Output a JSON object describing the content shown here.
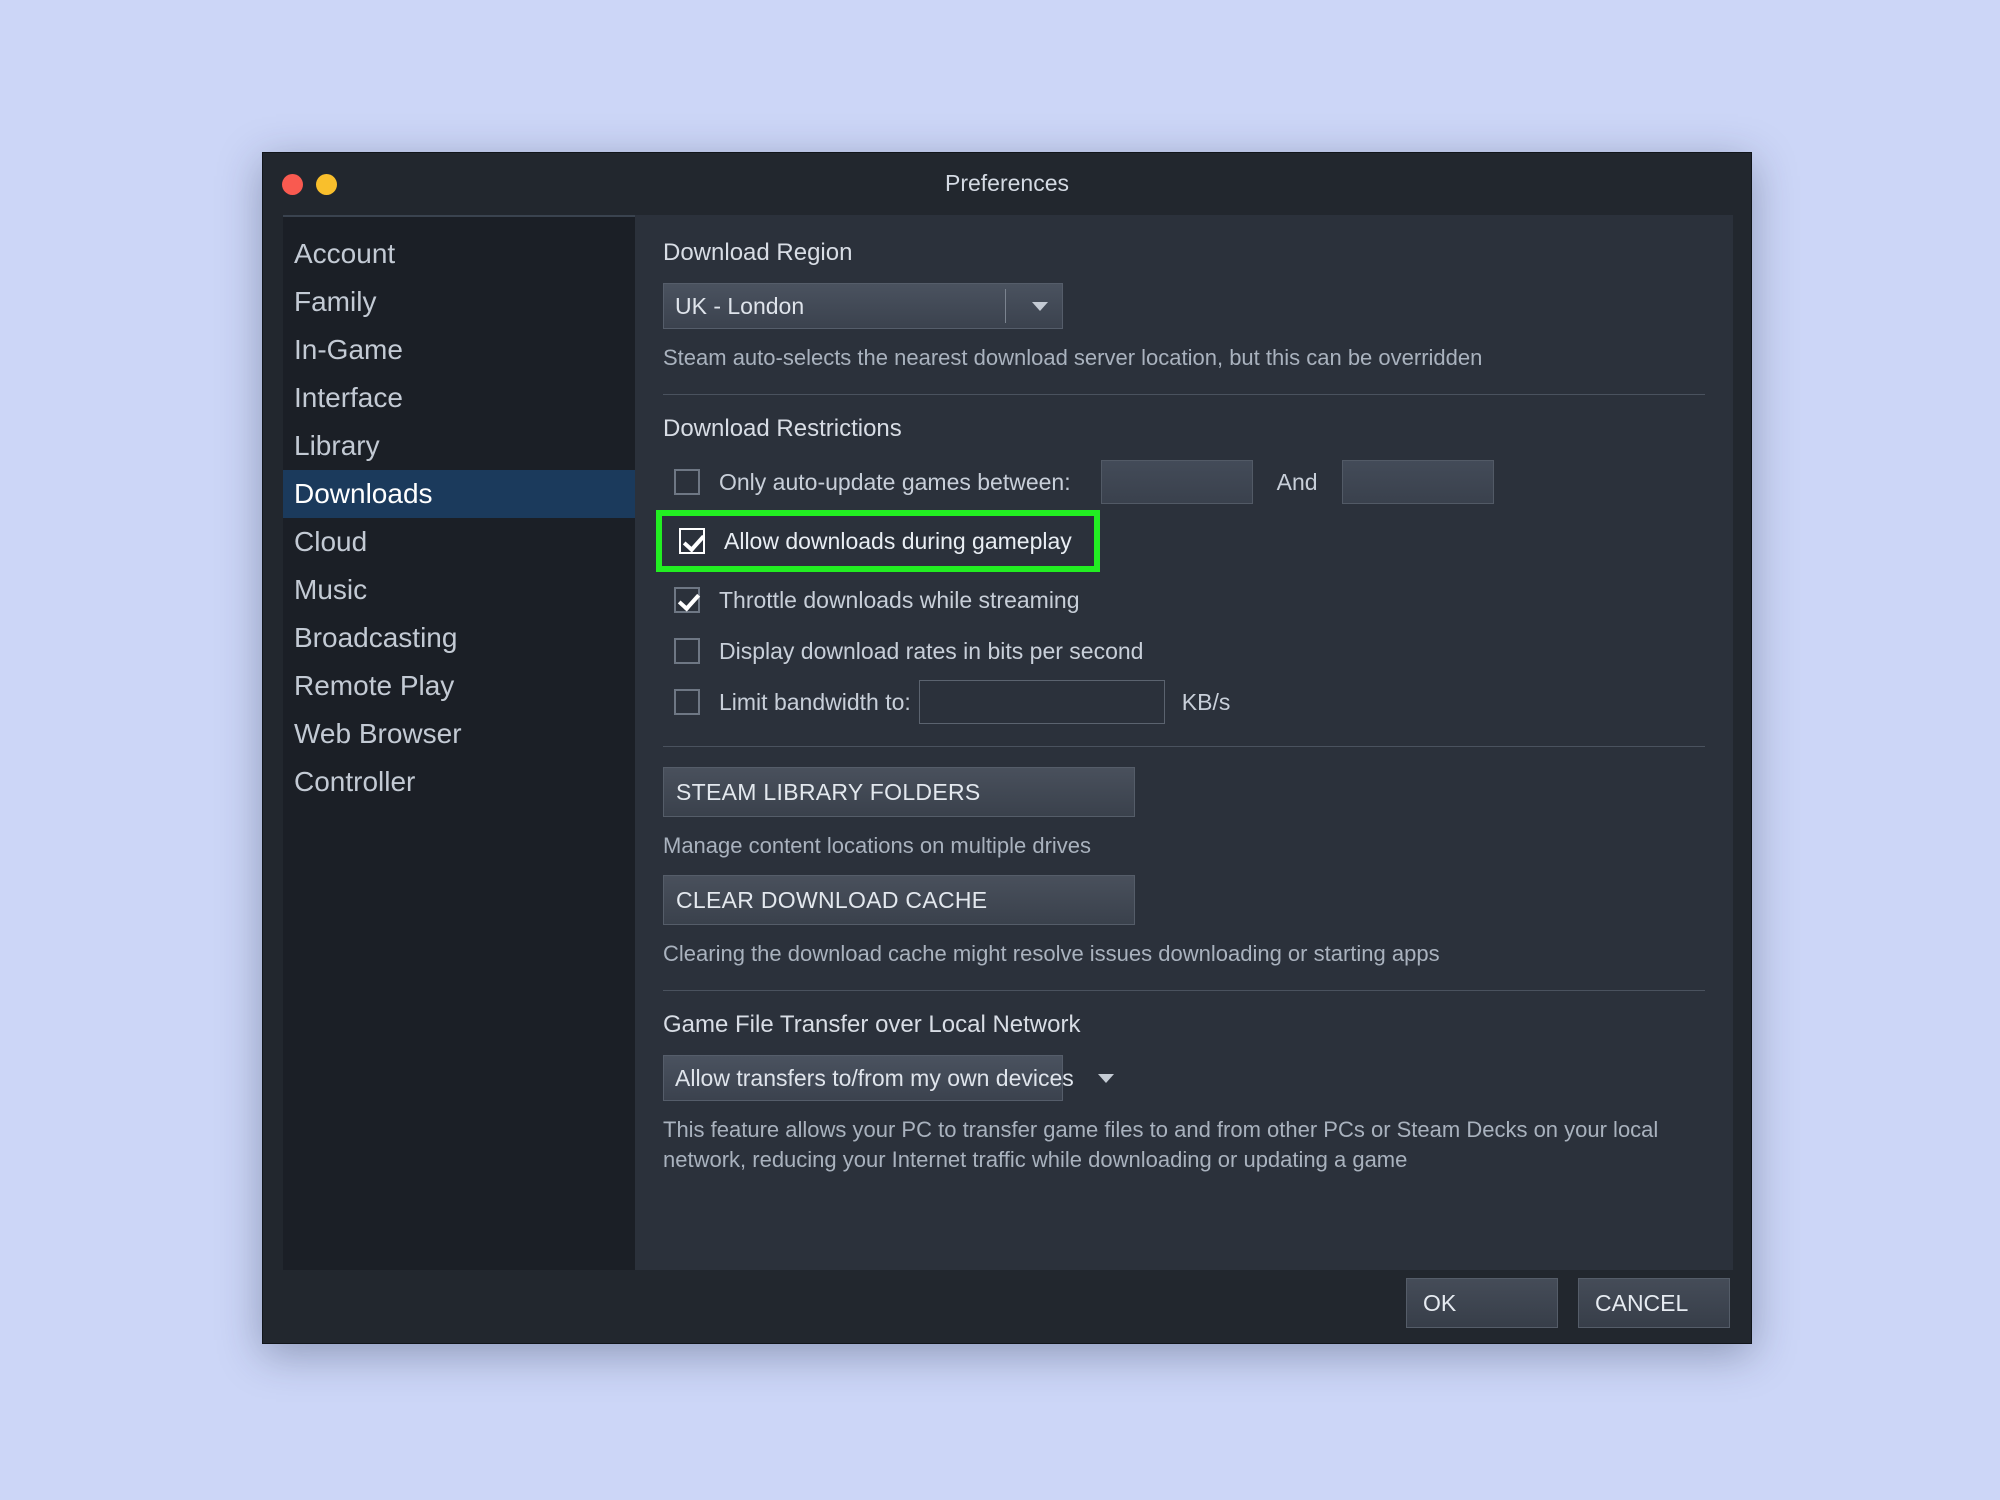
{
  "window": {
    "title": "Preferences",
    "traffic_lights": [
      {
        "name": "close-button",
        "color": "#f95a50"
      },
      {
        "name": "minimize-button",
        "color": "#f9bf2c"
      }
    ]
  },
  "sidebar": {
    "items": [
      {
        "label": "Account",
        "selected": false
      },
      {
        "label": "Family",
        "selected": false
      },
      {
        "label": "In-Game",
        "selected": false
      },
      {
        "label": "Interface",
        "selected": false
      },
      {
        "label": "Library",
        "selected": false
      },
      {
        "label": "Downloads",
        "selected": true
      },
      {
        "label": "Cloud",
        "selected": false
      },
      {
        "label": "Music",
        "selected": false
      },
      {
        "label": "Broadcasting",
        "selected": false
      },
      {
        "label": "Remote Play",
        "selected": false
      },
      {
        "label": "Web Browser",
        "selected": false
      },
      {
        "label": "Controller",
        "selected": false
      }
    ]
  },
  "download_region": {
    "heading": "Download Region",
    "selected_value": "UK - London",
    "description": "Steam auto-selects the nearest download server location, but this can be overridden"
  },
  "download_restrictions": {
    "heading": "Download Restrictions",
    "auto_update": {
      "label": "Only auto-update games between:",
      "checked": false,
      "start_time": "",
      "end_time": "",
      "and_label": "And"
    },
    "allow_during_gameplay": {
      "label": "Allow downloads during gameplay",
      "checked": true,
      "highlighted": true,
      "highlight_color": "#22ee22"
    },
    "throttle_while_streaming": {
      "label": "Throttle downloads while streaming",
      "checked": true
    },
    "bits_per_second": {
      "label": "Display download rates in bits per second",
      "checked": false
    },
    "limit_bandwidth": {
      "label": "Limit bandwidth to:",
      "checked": false,
      "value": "",
      "unit": "KB/s"
    }
  },
  "library_section": {
    "library_folders_button": "STEAM LIBRARY FOLDERS",
    "library_folders_desc": "Manage content locations on multiple drives",
    "clear_cache_button": "CLEAR DOWNLOAD CACHE",
    "clear_cache_desc": "Clearing the download cache might resolve issues downloading or starting apps"
  },
  "game_file_transfer": {
    "heading": "Game File Transfer over Local Network",
    "selected_value": "Allow transfers to/from my own devices",
    "description": "This feature allows your PC to transfer game files to and from other PCs or Steam Decks on your local network, reducing your Internet traffic while downloading or updating a game"
  },
  "footer": {
    "ok_label": "OK",
    "cancel_label": "CANCEL"
  }
}
